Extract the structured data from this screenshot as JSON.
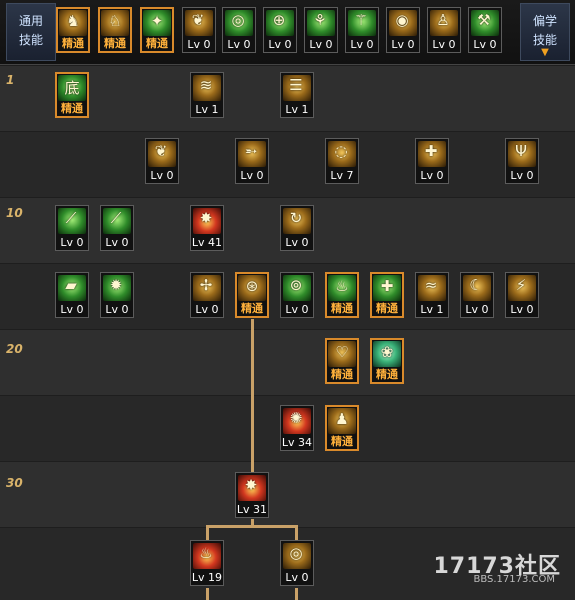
{
  "sidebar": {
    "common_skills": [
      "通用",
      "技能"
    ],
    "preferred_skills": [
      "偏学",
      "技能"
    ]
  },
  "level_markers": [
    "1",
    "10",
    "20",
    "30"
  ],
  "labels": {
    "master": "精通"
  },
  "top_icons": [
    {
      "id": "t1",
      "art": "gold",
      "glyph": "♞",
      "label": "精通",
      "master": true
    },
    {
      "id": "t2",
      "art": "gold",
      "glyph": "♘",
      "label": "精通",
      "master": true
    },
    {
      "id": "t3",
      "art": "green",
      "glyph": "✦",
      "label": "精通",
      "master": true
    },
    {
      "id": "t4",
      "art": "gold",
      "glyph": "❦",
      "label": "Lv 0",
      "master": false
    },
    {
      "id": "t5",
      "art": "green",
      "glyph": "◎",
      "label": "Lv 0",
      "master": false
    },
    {
      "id": "t6",
      "art": "green",
      "glyph": "⊕",
      "label": "Lv 0",
      "master": false
    },
    {
      "id": "t7",
      "art": "green",
      "glyph": "⚘",
      "label": "Lv 0",
      "master": false
    },
    {
      "id": "t8",
      "art": "green",
      "glyph": "⚚",
      "label": "Lv 0",
      "master": false
    },
    {
      "id": "t9",
      "art": "gold",
      "glyph": "◉",
      "label": "Lv 0",
      "master": false
    },
    {
      "id": "t10",
      "art": "gold",
      "glyph": "♙",
      "label": "Lv 0",
      "master": false
    },
    {
      "id": "t11",
      "art": "green",
      "glyph": "⚒",
      "label": "Lv 0",
      "master": false
    }
  ],
  "skills": [
    {
      "id": "s1",
      "art": "green",
      "glyph": "底",
      "label": "精通",
      "master": true
    },
    {
      "id": "s2",
      "art": "gold",
      "glyph": "≋",
      "label": "Lv 1",
      "master": false
    },
    {
      "id": "s3",
      "art": "gold",
      "glyph": "☰",
      "label": "Lv 1",
      "master": false
    },
    {
      "id": "s4",
      "art": "gold",
      "glyph": "❦",
      "label": "Lv 0",
      "master": false
    },
    {
      "id": "s5",
      "art": "gold",
      "glyph": "➵",
      "label": "Lv 0",
      "master": false
    },
    {
      "id": "s6",
      "art": "gold",
      "glyph": "◌",
      "label": "Lv 7",
      "master": false
    },
    {
      "id": "s7",
      "art": "gold",
      "glyph": "✚",
      "label": "Lv 0",
      "master": false
    },
    {
      "id": "s8",
      "art": "gold",
      "glyph": "Ψ",
      "label": "Lv 0",
      "master": false
    },
    {
      "id": "s9",
      "art": "green",
      "glyph": "⟋",
      "label": "Lv 0",
      "master": false
    },
    {
      "id": "s10",
      "art": "green",
      "glyph": "⟋",
      "label": "Lv 0",
      "master": false
    },
    {
      "id": "s11",
      "art": "red",
      "glyph": "✸",
      "label": "Lv 41",
      "master": false
    },
    {
      "id": "s12",
      "art": "gold",
      "glyph": "↻",
      "label": "Lv 0",
      "master": false
    },
    {
      "id": "s13",
      "art": "green",
      "glyph": "▰",
      "label": "Lv 0",
      "master": false
    },
    {
      "id": "s14",
      "art": "green",
      "glyph": "✹",
      "label": "Lv 0",
      "master": false
    },
    {
      "id": "s15",
      "art": "gold",
      "glyph": "✢",
      "label": "Lv 0",
      "master": false
    },
    {
      "id": "s16",
      "art": "gold",
      "glyph": "⊛",
      "label": "精通",
      "master": true
    },
    {
      "id": "s17",
      "art": "green",
      "glyph": "⊚",
      "label": "Lv 0",
      "master": false
    },
    {
      "id": "s18",
      "art": "green",
      "glyph": "♨",
      "label": "精通",
      "master": true
    },
    {
      "id": "s19",
      "art": "green",
      "glyph": "✚",
      "label": "精通",
      "master": true
    },
    {
      "id": "s20",
      "art": "gold",
      "glyph": "≈",
      "label": "Lv 1",
      "master": false
    },
    {
      "id": "s21",
      "art": "gold",
      "glyph": "☾",
      "label": "Lv 0",
      "master": false
    },
    {
      "id": "s22",
      "art": "gold",
      "glyph": "⚡",
      "label": "Lv 0",
      "master": false
    },
    {
      "id": "s23",
      "art": "gold",
      "glyph": "♡",
      "label": "精通",
      "master": true
    },
    {
      "id": "s24",
      "art": "teal",
      "glyph": "❀",
      "label": "精通",
      "master": true
    },
    {
      "id": "s25",
      "art": "red",
      "glyph": "✺",
      "label": "Lv 34",
      "master": false
    },
    {
      "id": "s26",
      "art": "gold",
      "glyph": "♟",
      "label": "精通",
      "master": true
    },
    {
      "id": "s27",
      "art": "red",
      "glyph": "✸",
      "label": "Lv 31",
      "master": false
    },
    {
      "id": "s28",
      "art": "red",
      "glyph": "♨",
      "label": "Lv 19",
      "master": false
    },
    {
      "id": "s29",
      "art": "gold",
      "glyph": "◎",
      "label": "Lv 0",
      "master": false
    }
  ],
  "watermark": {
    "brand": "17173社区",
    "url": "BBS.17173.COM"
  },
  "colors": {
    "master_border": "#d98a2b",
    "master_text": "#ffb13b",
    "level_marker": "#d9b36a",
    "connector": "#c9a168"
  }
}
